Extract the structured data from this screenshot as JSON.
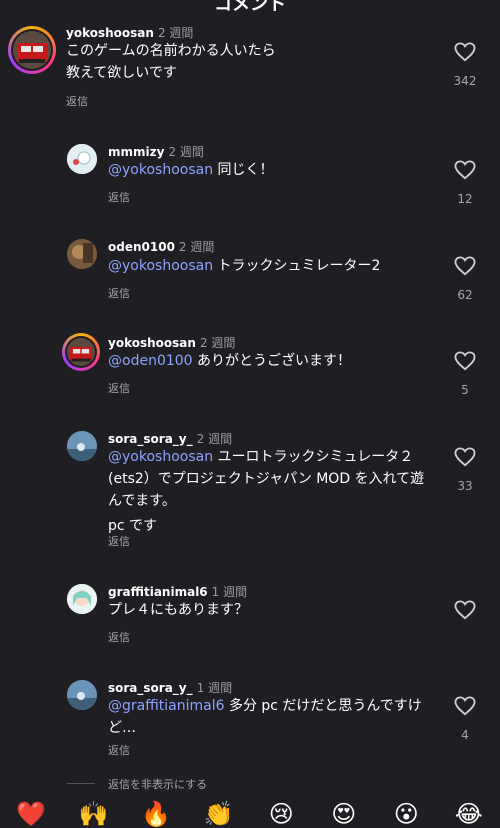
{
  "header": {
    "title": "コメント"
  },
  "reply_label": "返信",
  "comments": [
    {
      "user": "yokoshoosan",
      "time": "2 週間",
      "lines": [
        "このゲームの名前わかる人いたら",
        "教えて欲しいです"
      ],
      "likes": "342",
      "avatar": "red-truck",
      "ring": true
    },
    {
      "user": "mmmizy",
      "time": "2 週間",
      "mention": "@yokoshoosan",
      "text": "同じく！",
      "likes": "12",
      "avatar": "white-sketch"
    },
    {
      "user": "oden0100",
      "time": "2 週間",
      "mention": "@yokoshoosan",
      "text": "トラックシュミレーター2",
      "likes": "62",
      "avatar": "brown-photo"
    },
    {
      "user": "yokoshoosan",
      "time": "2 週間",
      "mention": "@oden0100",
      "text": "ありがとうございます！",
      "likes": "5",
      "avatar": "red-truck",
      "ring": true
    },
    {
      "user": "sora_sora_y_",
      "time": "2 週間",
      "mention": "@yokoshoosan",
      "text_line1": "ユーロトラックシミュレータ２",
      "text_line2": "(ets2）でプロジェクトジャパン MOD を入れて遊",
      "text_line3": "んでます。",
      "text_line4": "pc です",
      "likes": "33",
      "avatar": "sky-photo"
    },
    {
      "user": "graffitianimal6",
      "time": "1 週間",
      "text": "プレ４にもあります？",
      "likes": "",
      "avatar": "anime-girl"
    },
    {
      "user": "sora_sora_y_",
      "time": "1 週間",
      "mention": "@graffitianimal6",
      "text": "多分 pc だけだと思うんですけ",
      "text_line2": "ど…",
      "likes": "4",
      "avatar": "sky-photo"
    }
  ],
  "hide_replies": "返信を非表示にする",
  "emoji_bar": [
    "❤️",
    "🙌",
    "🔥",
    "👏",
    "😢",
    "😍",
    "😮",
    "😂"
  ]
}
